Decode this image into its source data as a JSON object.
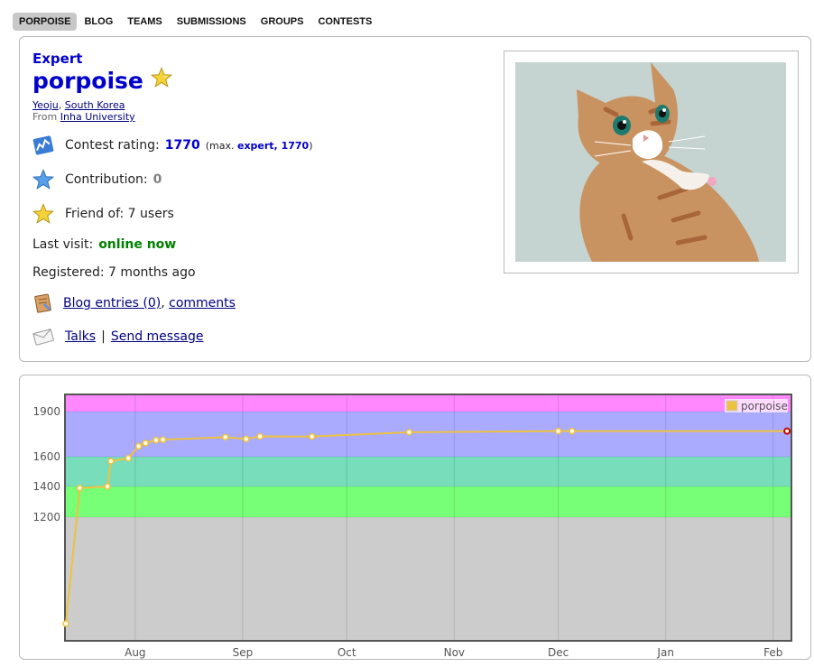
{
  "nav": {
    "items": [
      "PORPOISE",
      "BLOG",
      "TEAMS",
      "SUBMISSIONS",
      "GROUPS",
      "CONTESTS"
    ],
    "active_index": 0
  },
  "profile": {
    "rank": "Expert",
    "handle": "porpoise",
    "city": "Yeoju",
    "country": "South Korea",
    "from_label": "From",
    "organization": "Inha University",
    "rating_label": "Contest rating:",
    "rating": "1770",
    "max_prefix": "(max.",
    "max_rank_rating": "expert, 1770",
    "max_suffix": ")",
    "contribution_label": "Contribution:",
    "contribution": "0",
    "friend_label": "Friend of: 7 users",
    "last_visit_label": "Last visit:",
    "last_visit": "online now",
    "registered": "Registered: 7 months ago",
    "blog_entries": "Blog entries (0)",
    "comments": "comments",
    "talks": "Talks",
    "send_message": "Send message",
    "colors": {
      "rank": "#0000cc",
      "online": "#008000",
      "contribution": "#808080"
    }
  },
  "chart_data": {
    "type": "line",
    "series": [
      {
        "name": "porpoise",
        "color": "#edc240",
        "points": [
          [
            "07-12",
            1000
          ],
          [
            "07-16",
            1390
          ],
          [
            "07-24",
            1400
          ],
          [
            "07-25",
            1570
          ],
          [
            "07-30",
            1590
          ],
          [
            "08-02",
            1670
          ],
          [
            "08-04",
            1690
          ],
          [
            "08-07",
            1710
          ],
          [
            "08-09",
            1713
          ],
          [
            "08-27",
            1730
          ],
          [
            "09-02",
            1718
          ],
          [
            "09-06",
            1735
          ],
          [
            "09-21",
            1734
          ],
          [
            "10-19",
            1763
          ],
          [
            "12-01",
            1770
          ],
          [
            "12-05",
            1770
          ],
          [
            "02-05",
            1770
          ]
        ]
      }
    ],
    "x_ticks": [
      "Aug",
      "Sep",
      "Oct",
      "Nov",
      "Dec",
      "Jan",
      "Feb"
    ],
    "y_ticks": [
      1200,
      1400,
      1600,
      1900
    ],
    "legend": "top-right",
    "grid": true,
    "bands": [
      {
        "from": 0,
        "to": 1200,
        "color": "#cccccc"
      },
      {
        "from": 1200,
        "to": 1400,
        "color": "#77ff77"
      },
      {
        "from": 1400,
        "to": 1600,
        "color": "#77ddbb"
      },
      {
        "from": 1600,
        "to": 1900,
        "color": "#aaaaff"
      },
      {
        "from": 1900,
        "to": 2000,
        "color": "#ff88ff"
      }
    ]
  }
}
